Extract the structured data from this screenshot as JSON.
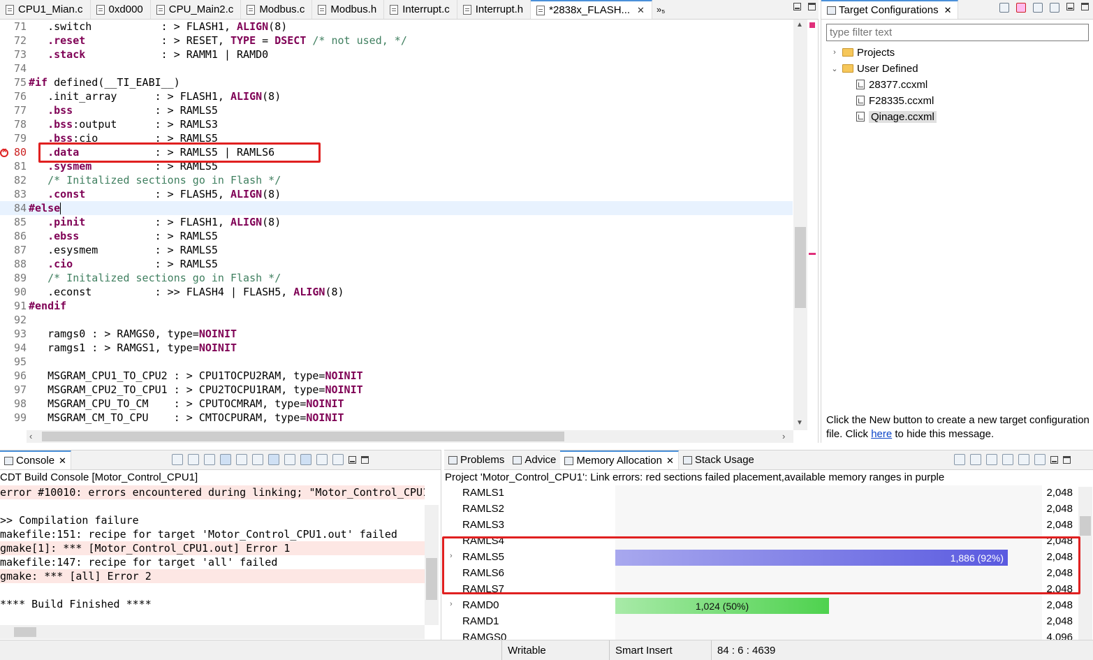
{
  "editor_tabs": [
    {
      "label": "CPU1_Mian.c",
      "active": false
    },
    {
      "label": "0xd000",
      "active": false
    },
    {
      "label": "CPU_Main2.c",
      "active": false
    },
    {
      "label": "Modbus.c",
      "active": false
    },
    {
      "label": "Modbus.h",
      "active": false
    },
    {
      "label": "Interrupt.c",
      "active": false
    },
    {
      "label": "Interrupt.h",
      "active": false
    },
    {
      "label": "*2838x_FLASH...",
      "active": true
    }
  ],
  "editor_tab_overflow": "»₅",
  "code_lines": [
    {
      "n": "71",
      "text": "   .switch           : > FLASH1, ALIGN(8)"
    },
    {
      "n": "72",
      "text": "   .reset            : > RESET, TYPE = DSECT /* not used, */"
    },
    {
      "n": "73",
      "text": "   .stack            : > RAMM1 | RAMD0"
    },
    {
      "n": "74",
      "text": ""
    },
    {
      "n": "75",
      "text": "#if defined(__TI_EABI__)"
    },
    {
      "n": "76",
      "text": "   .init_array      : > FLASH1, ALIGN(8)"
    },
    {
      "n": "77",
      "text": "   .bss             : > RAMLS5"
    },
    {
      "n": "78",
      "text": "   .bss:output      : > RAMLS3"
    },
    {
      "n": "79",
      "text": "   .bss:cio         : > RAMLS5"
    },
    {
      "n": "80",
      "text": "   .data            : > RAMLS5 | RAMLS6"
    },
    {
      "n": "81",
      "text": "   .sysmem          : > RAMLS5"
    },
    {
      "n": "82",
      "text": "   /* Initalized sections go in Flash */"
    },
    {
      "n": "83",
      "text": "   .const           : > FLASH5, ALIGN(8)"
    },
    {
      "n": "84",
      "text": "#else"
    },
    {
      "n": "85",
      "text": "   .pinit           : > FLASH1, ALIGN(8)"
    },
    {
      "n": "86",
      "text": "   .ebss            : > RAMLS5"
    },
    {
      "n": "87",
      "text": "   .esysmem         : > RAMLS5"
    },
    {
      "n": "88",
      "text": "   .cio             : > RAMLS5"
    },
    {
      "n": "89",
      "text": "   /* Initalized sections go in Flash */"
    },
    {
      "n": "90",
      "text": "   .econst          : >> FLASH4 | FLASH5, ALIGN(8)"
    },
    {
      "n": "91",
      "text": "#endif"
    },
    {
      "n": "92",
      "text": ""
    },
    {
      "n": "93",
      "text": "   ramgs0 : > RAMGS0, type=NOINIT"
    },
    {
      "n": "94",
      "text": "   ramgs1 : > RAMGS1, type=NOINIT"
    },
    {
      "n": "95",
      "text": ""
    },
    {
      "n": "96",
      "text": "   MSGRAM_CPU1_TO_CPU2 : > CPU1TOCPU2RAM, type=NOINIT"
    },
    {
      "n": "97",
      "text": "   MSGRAM_CPU2_TO_CPU1 : > CPU2TOCPU1RAM, type=NOINIT"
    },
    {
      "n": "98",
      "text": "   MSGRAM_CPU_TO_CM    : > CPUTOCMRAM, type=NOINIT"
    },
    {
      "n": "99",
      "text": "   MSGRAM_CM_TO_CPU    : > CMTOCPURAM, type=NOINIT"
    }
  ],
  "target_config": {
    "tab_label": "Target Configurations",
    "filter_placeholder": "type filter text",
    "tree": [
      {
        "label": "Projects",
        "kind": "folder",
        "expanded": false,
        "depth": 0
      },
      {
        "label": "User Defined",
        "kind": "folder",
        "expanded": true,
        "depth": 0
      },
      {
        "label": "28377.ccxml",
        "kind": "file",
        "depth": 1
      },
      {
        "label": "F28335.ccxml",
        "kind": "file",
        "depth": 1
      },
      {
        "label": "Qinage.ccxml",
        "kind": "file",
        "depth": 1,
        "selected": true
      }
    ],
    "message_before": "Click the New button to create a new target configuration file. Click ",
    "message_link": "here",
    "message_after": " to hide this message."
  },
  "console": {
    "tab_label": "Console",
    "title": "CDT Build Console [Motor_Control_CPU1]",
    "lines": [
      {
        "text": "error #10010: errors encountered during linking; \"Motor_Control_CPU1",
        "error": true
      },
      {
        "text": "",
        "error": false
      },
      {
        "text": ">> Compilation failure",
        "error": false
      },
      {
        "text": "makefile:151: recipe for target 'Motor_Control_CPU1.out' failed",
        "error": false
      },
      {
        "text": "gmake[1]: *** [Motor_Control_CPU1.out] Error 1",
        "error": true
      },
      {
        "text": "makefile:147: recipe for target 'all' failed",
        "error": false
      },
      {
        "text": "gmake: *** [all] Error 2",
        "error": true
      },
      {
        "text": "",
        "error": false
      },
      {
        "text": "**** Build Finished ****",
        "error": false
      }
    ]
  },
  "bottom_tabs": [
    {
      "label": "Problems",
      "active": false
    },
    {
      "label": "Advice",
      "active": false
    },
    {
      "label": "Memory Allocation",
      "active": true
    },
    {
      "label": "Stack Usage",
      "active": false
    }
  ],
  "memory": {
    "subtitle": "Project 'Motor_Control_CPU1': Link errors: red sections failed placement,available memory ranges in purple",
    "rows": [
      {
        "name": "RAMLS1",
        "size": "2,048",
        "expandable": false,
        "fill": 0,
        "label": "",
        "color": ""
      },
      {
        "name": "RAMLS2",
        "size": "2,048",
        "expandable": false,
        "fill": 0,
        "label": "",
        "color": ""
      },
      {
        "name": "RAMLS3",
        "size": "2,048",
        "expandable": false,
        "fill": 0,
        "label": "",
        "color": ""
      },
      {
        "name": "RAMLS4",
        "size": "2,048",
        "expandable": false,
        "fill": 0,
        "label": "",
        "color": ""
      },
      {
        "name": "RAMLS5",
        "size": "2,048",
        "expandable": true,
        "fill": 0.92,
        "label": "1,886 (92%)",
        "color": "purple"
      },
      {
        "name": "RAMLS6",
        "size": "2,048",
        "expandable": false,
        "fill": 0,
        "label": "",
        "color": ""
      },
      {
        "name": "RAMLS7",
        "size": "2,048",
        "expandable": false,
        "fill": 0,
        "label": "",
        "color": ""
      },
      {
        "name": "RAMD0",
        "size": "2,048",
        "expandable": true,
        "fill": 0.5,
        "label": "1,024 (50%)",
        "color": "green"
      },
      {
        "name": "RAMD1",
        "size": "2,048",
        "expandable": false,
        "fill": 0,
        "label": "",
        "color": ""
      },
      {
        "name": "RAMGS0",
        "size": "4,096",
        "expandable": false,
        "fill": 0,
        "label": "",
        "color": ""
      }
    ]
  },
  "status_bar": {
    "writable": "Writable",
    "insert_mode": "Smart Insert",
    "position": "84 : 6 : 4639"
  },
  "colors": {
    "accent": "#4a90d9",
    "error_highlight": "#e02020",
    "keyword": "#7f0055",
    "comment": "#3f7f5f",
    "purple_bar": "#5a5ae0",
    "green_bar": "#4ed24e"
  }
}
